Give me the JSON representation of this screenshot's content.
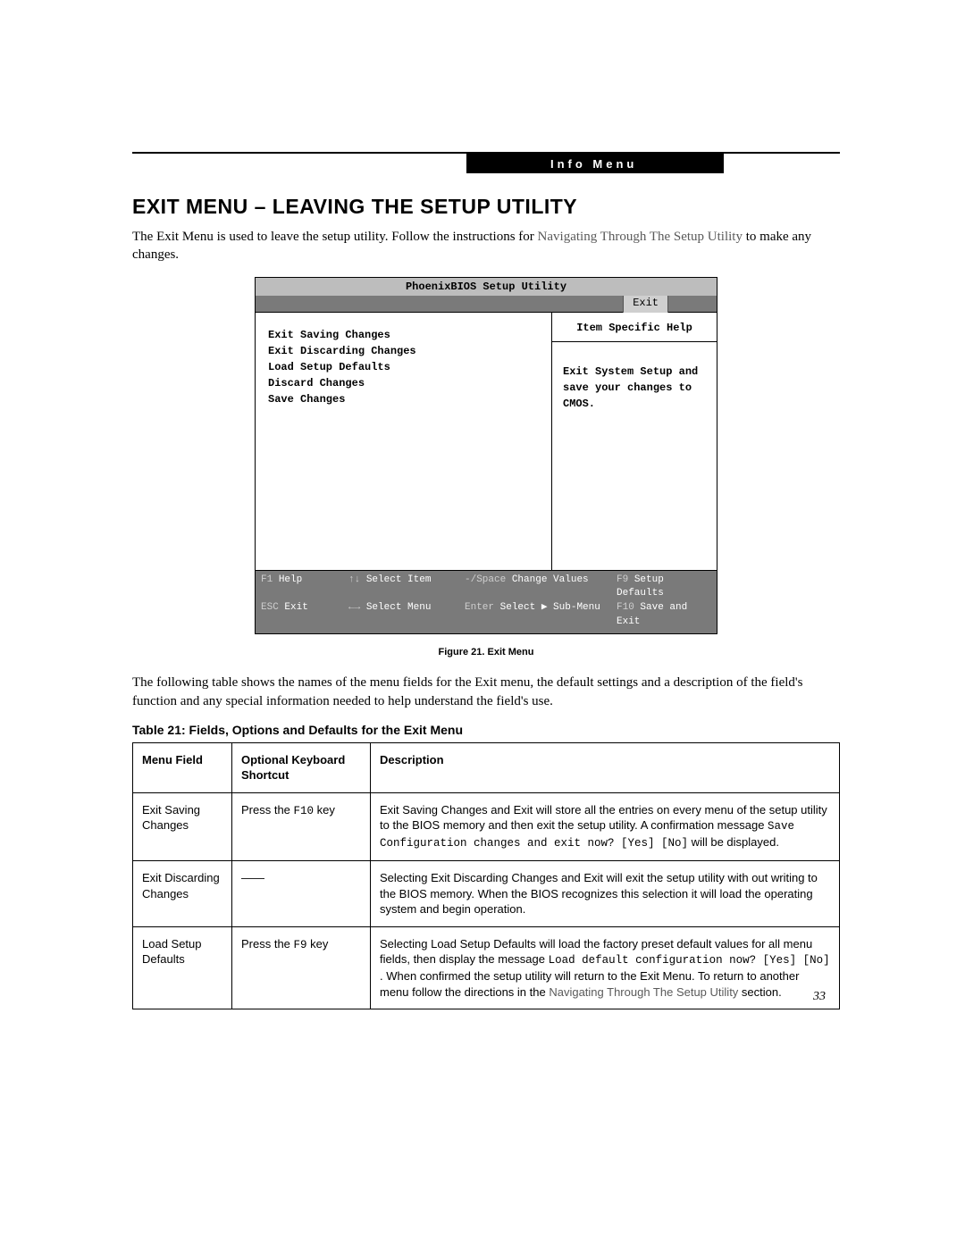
{
  "header": {
    "label": "Info Menu"
  },
  "title": "EXIT MENU – LEAVING THE SETUP UTILITY",
  "intro": {
    "pre": "The Exit Menu is used to leave the setup utility. Follow the instructions for ",
    "link": "Navigating Through The Setup Utility",
    "post": " to make any changes."
  },
  "bios": {
    "title": "PhoenixBIOS Setup Utility",
    "tab": "Exit",
    "menu_items": [
      "Exit Saving Changes",
      "Exit Discarding Changes",
      "Load Setup Defaults",
      "Discard Changes",
      "Save Changes"
    ],
    "help_title": "Item Specific Help",
    "help_body": "Exit System Setup and save your changes to CMOS.",
    "footer": {
      "r1c1k": "F1",
      "r1c1t": "Help",
      "r1c2k": "↑↓",
      "r1c2t": "Select Item",
      "r1c3k": "-/Space",
      "r1c3t": "Change Values",
      "r1c4k": "F9",
      "r1c4t": "Setup Defaults",
      "r2c1k": "ESC",
      "r2c1t": "Exit",
      "r2c2k": "←→",
      "r2c2t": "Select Menu",
      "r2c3k": "Enter",
      "r2c3t": "Select ▶ Sub-Menu",
      "r2c4k": "F10",
      "r2c4t": "Save and Exit"
    }
  },
  "figure_caption": "Figure 21.  Exit Menu",
  "after_fig": "The following table shows the names of the menu fields for the Exit menu, the default settings and a description of the field's function and any special information needed to help understand the field's use.",
  "table_title": "Table 21: Fields, Options and Defaults for the Exit Menu",
  "table": {
    "headers": {
      "mf": "Menu Field",
      "ks": "Optional Keyboard Shortcut",
      "desc": "Description"
    },
    "rows": [
      {
        "mf": "Exit Saving Changes",
        "ks_pre": "Press the ",
        "ks_mono": "F10",
        "ks_post": " key",
        "desc_parts": [
          {
            "t": "Exit Saving Changes and Exit will store all the entries on every menu of the setup utility to the BIOS memory and then exit the setup utility. A confirmation message "
          },
          {
            "m": "Save Configuration changes and exit now? [Yes] [No]"
          },
          {
            "t": " will be displayed."
          }
        ]
      },
      {
        "mf": "Exit Discarding Changes",
        "ks_plain": "——",
        "desc_parts": [
          {
            "t": "Selecting Exit Discarding Changes and Exit will exit the setup utility with out writing to the BIOS memory. When the BIOS recognizes this selection it will load the operating system and begin operation."
          }
        ]
      },
      {
        "mf": "Load Setup Defaults",
        "ks_pre": "Press the ",
        "ks_mono": "F9",
        "ks_post": " key",
        "desc_parts": [
          {
            "t": "Selecting Load Setup Defaults will load the factory preset default values for all menu fields, then display the message "
          },
          {
            "m": "Load default configuration now? [Yes] [No]"
          },
          {
            "t": " . When confirmed the setup utility will return to the Exit Menu. To return to another menu follow the directions in the "
          },
          {
            "nav": "Navigating Through The Setup Utility"
          },
          {
            "t": " section."
          }
        ]
      }
    ]
  },
  "page_number": "33"
}
